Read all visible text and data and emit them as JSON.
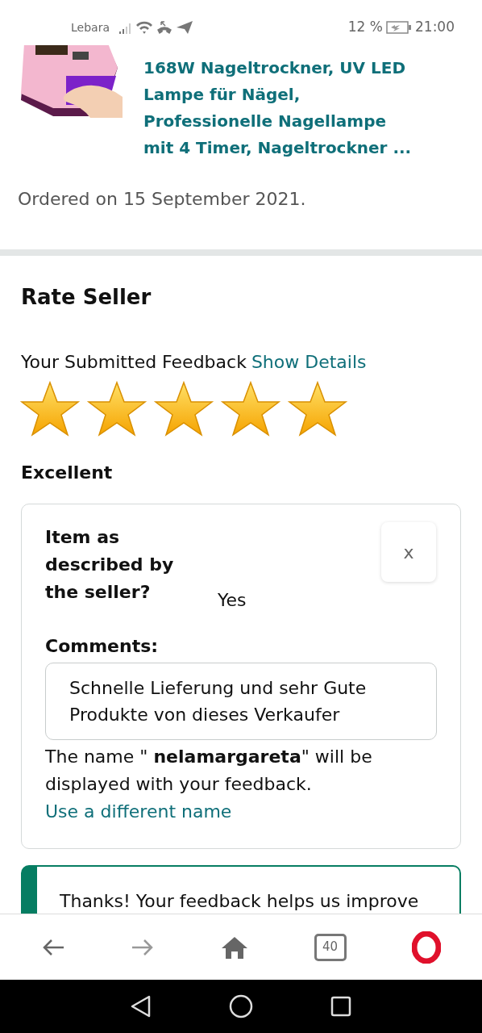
{
  "status_bar": {
    "carrier": "Lebara",
    "battery": "12 %",
    "time": "21:00"
  },
  "product": {
    "title": "168W Nageltrockner, UV LED Lampe für Nägel, Professionelle Nagellampe mit 4 Timer, Nageltrockner ...",
    "ordered": "Ordered on 15 September 2021."
  },
  "rate_seller": {
    "heading": "Rate Seller",
    "feedback_label": "Your Submitted Feedback",
    "show_details": "Show Details",
    "stars": 5,
    "rating_label": "Excellent"
  },
  "feedback_card": {
    "question": "Item as described by the seller?",
    "answer": "Yes",
    "close": "x",
    "comments_label": "Comments:",
    "comment": "Schnelle Lieferung und sehr Gute Produkte von dieses Verkaufer",
    "name_notice": "The name \" **nelamargareta**\" will be displayed with your feedback.",
    "name_link": "Use a different name"
  },
  "notice": {
    "text": "Thanks! Your feedback helps us improve"
  },
  "browser_bar": {
    "tab_count": "40"
  }
}
